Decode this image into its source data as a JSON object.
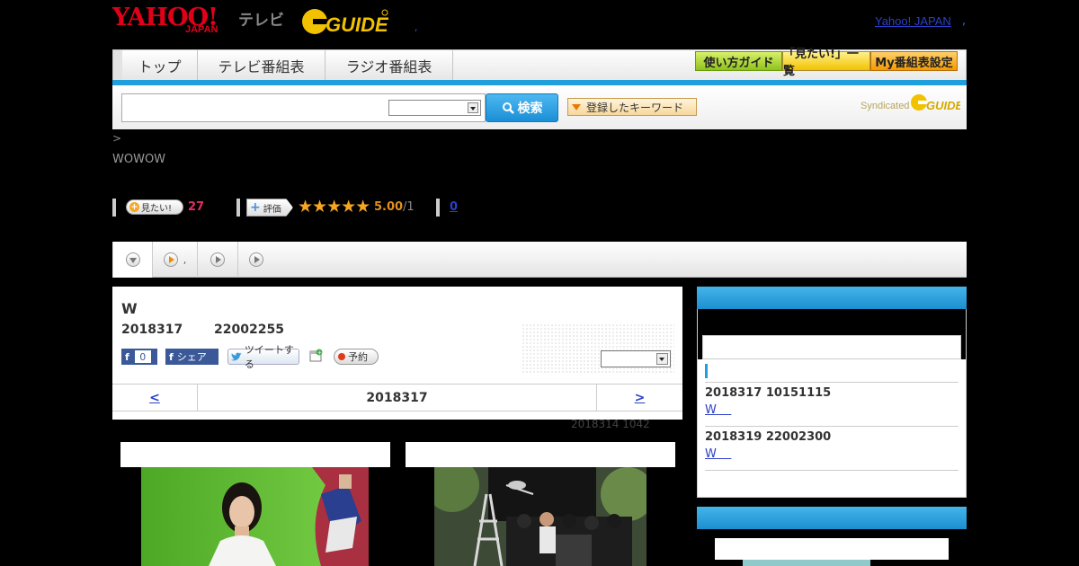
{
  "header": {
    "yahoo_logo": "YAHOO!",
    "yahoo_japan": "JAPAN",
    "tv_word": "テレビ",
    "gguide_logo": "G GUIDE",
    "top_dot": ",",
    "yahoo_link": "Yahoo! JAPAN",
    "yahoo_link_dot": ","
  },
  "nav": {
    "tabs": [
      "トップ",
      "テレビ番組表",
      "ラジオ番組表"
    ],
    "buttons": [
      "使い方ガイド",
      "「見たい!」一覧",
      "My番組表設定"
    ]
  },
  "search": {
    "button_label": "検索",
    "keyword_button": "登録したキーワード",
    "syndicated": "Syndicated"
  },
  "crumb": ">",
  "channel": "WOWOW",
  "stats": {
    "mitai_label": "見たい!",
    "mitai_count": "27",
    "hyoka_label": "評価",
    "stars": "★★★★★",
    "rating": "5.00",
    "rating_denom": "/1",
    "count_link": "0"
  },
  "tabs": [
    ",",
    "",
    ""
  ],
  "program": {
    "title": "W",
    "date": "2018317",
    "time": "22002255",
    "fb_like_count": "0",
    "fb_share": "シェア",
    "tweet": "ツイートする",
    "yoyaku": "予約"
  },
  "date_nav": {
    "prev": "<",
    "date": "2018317",
    "next": ">"
  },
  "updated": "2018314  1042",
  "sidebar": {
    "entries": [
      {
        "date": "2018317  10151115",
        "link": "W"
      },
      {
        "date": "2018319  22002300",
        "link": "W"
      }
    ]
  },
  "colors": {
    "accent_blue": "#1fa0dc",
    "yahoo_red": "#e0001a",
    "link": "#2b40c8",
    "star": "#f5a623"
  }
}
